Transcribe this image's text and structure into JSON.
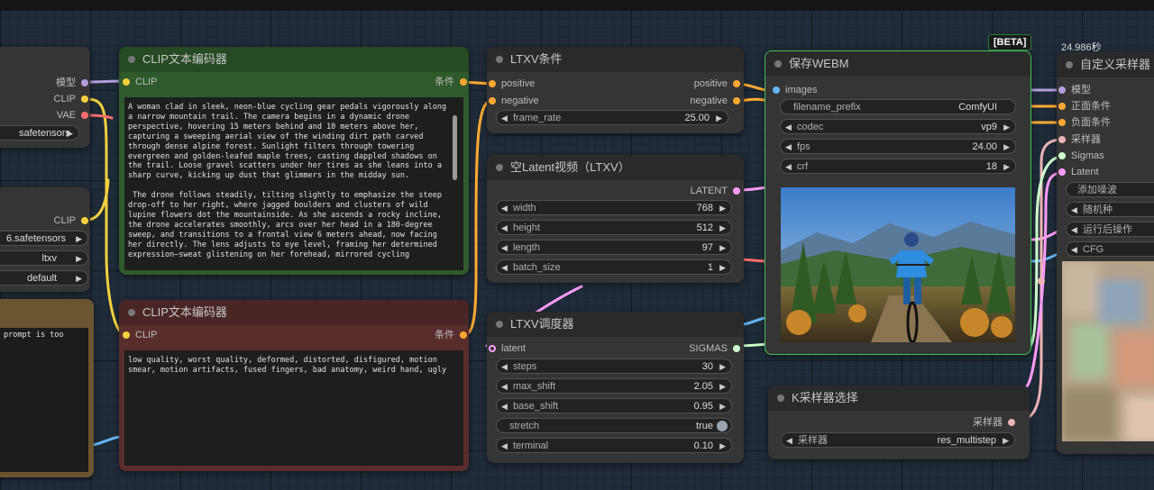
{
  "colors": {
    "clip": "#f4d03f",
    "vae": "#ff6e6e",
    "model": "#b39ddb",
    "cond": "#ffa931",
    "latent": "#ff9cf9",
    "sigmas": "#cdffcd",
    "sampler": "#ecb4b4",
    "image": "#64b5f6",
    "green_node": "#2f5a2c",
    "red_node": "#5a2d2d",
    "brown_node": "#6b5530"
  },
  "left": {
    "out_model": "模型",
    "out_clip": "CLIP",
    "out_vae": "VAE",
    "ckpt_value": "safetensors",
    "out_clip2": "CLIP",
    "clip_name": "6.safetensors",
    "type": "ltxv",
    "device": "default",
    "note_text": "prompt is too"
  },
  "clip_pos": {
    "title": "CLIP文本编码器",
    "in_clip": "CLIP",
    "out": "条件",
    "text": "A woman clad in sleek, neon-blue cycling gear pedals vigorously along\na narrow mountain trail. The camera begins in a dynamic drone\nperspective, hovering 15 meters behind and 10 meters above her,\ncapturing a sweeping aerial view of the winding dirt path carved\nthrough dense alpine forest. Sunlight filters through towering\nevergreen and golden-leafed maple trees, casting dappled shadows on\nthe trail. Loose gravel scatters under her tires as she leans into a\nsharp curve, kicking up dust that glimmers in the midday sun.\n\n The drone follows steadily, tilting slightly to emphasize the steep\ndrop-off to her right, where jagged boulders and clusters of wild\nlupine flowers dot the mountainside. As she ascends a rocky incline,\nthe drone accelerates smoothly, arcs over her head in a 180-degree\nsweep, and transitions to a frontal view 6 meters ahead, now facing\nher directly. The lens adjusts to eye level, framing her determined\nexpression—sweat glistening on her forehead, mirrored cycling"
  },
  "clip_neg": {
    "title": "CLIP文本编码器",
    "in_clip": "CLIP",
    "out": "条件",
    "text": "low quality, worst quality, deformed, distorted, disfigured, motion\nsmear, motion artifacts, fused fingers, bad anatomy, weird hand, ugly"
  },
  "ltxv_cond": {
    "title": "LTXV条件",
    "in_pos": "positive",
    "in_neg": "negative",
    "out_pos": "positive",
    "out_neg": "negative",
    "frame_rate_label": "frame_rate",
    "frame_rate": "25.00"
  },
  "empty_latent": {
    "title": "空Latent视频（LTXV）",
    "out": "LATENT",
    "widgets": [
      {
        "label": "width",
        "value": "768"
      },
      {
        "label": "height",
        "value": "512"
      },
      {
        "label": "length",
        "value": "97"
      },
      {
        "label": "batch_size",
        "value": "1"
      }
    ]
  },
  "scheduler": {
    "title": "LTXV调度器",
    "in_latent": "latent",
    "out": "SIGMAS",
    "widgets": [
      {
        "label": "steps",
        "value": "30"
      },
      {
        "label": "max_shift",
        "value": "2.05"
      },
      {
        "label": "base_shift",
        "value": "0.95"
      }
    ],
    "stretch_label": "stretch",
    "stretch_value": "true",
    "terminal_label": "terminal",
    "terminal_value": "0.10"
  },
  "save_webm": {
    "title": "保存WEBM",
    "badge": "[BETA]",
    "in_images": "images",
    "prefix_label": "filename_prefix",
    "prefix_value": "ComfyUI",
    "widgets": [
      {
        "label": "codec",
        "value": "vp9"
      },
      {
        "label": "fps",
        "value": "24.00"
      },
      {
        "label": "crf",
        "value": "18"
      }
    ],
    "preview_icon": "cyclist-preview-image"
  },
  "ksampler_select": {
    "title": "K采样器选择",
    "out": "采样器",
    "widget_label": "采样器",
    "widget_value": "res_multistep"
  },
  "custom_sampler": {
    "timing": "24.986秒",
    "title": "自定义采样器",
    "inputs": [
      "模型",
      "正面条件",
      "负面条件",
      "采样器",
      "Sigmas",
      "Latent"
    ],
    "widgets": [
      "添加噪波",
      "随机种",
      "运行后操作",
      "CFG"
    ]
  }
}
